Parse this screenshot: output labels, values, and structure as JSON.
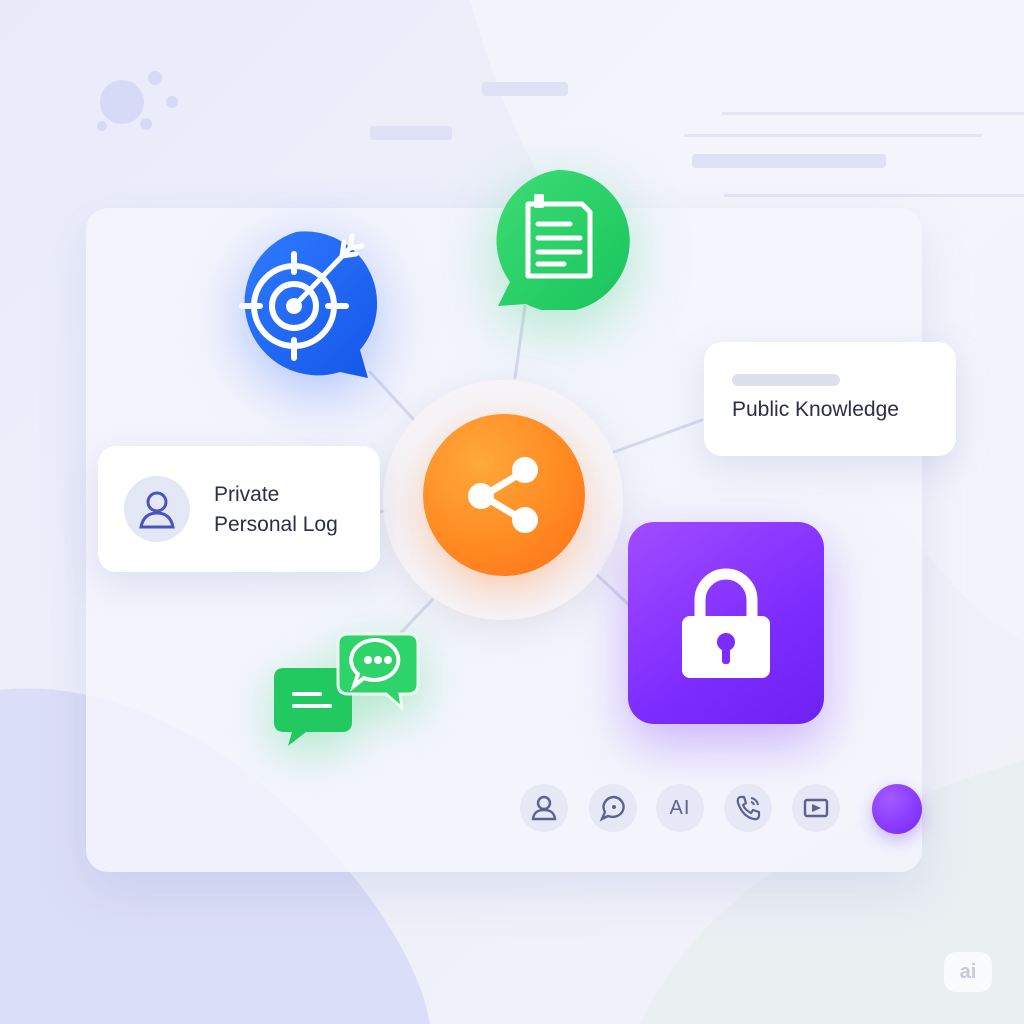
{
  "colors": {
    "target_blue": "#1e66f5",
    "doc_green": "#22cc66",
    "hub_orange": "#ff8a22",
    "lock_purple": "#7d2cff",
    "text_dark": "#2b2f48",
    "icon_muted": "#5b6293"
  },
  "nodes": {
    "target": {
      "icon": "target-icon"
    },
    "document": {
      "icon": "document-icon"
    },
    "hub": {
      "icon": "share-icon"
    },
    "chat": {
      "icon": "chat-bubbles-icon"
    },
    "lock": {
      "icon": "lock-icon"
    }
  },
  "private_card": {
    "line1": "Private",
    "line2": "Personal Log",
    "icon": "user-icon"
  },
  "public_card": {
    "label": "Public Knowledge"
  },
  "toolbar": {
    "items": [
      {
        "icon": "user-icon"
      },
      {
        "icon": "chat-icon"
      },
      {
        "icon": "text-ai-icon",
        "label": "AI"
      },
      {
        "icon": "phone-icon"
      },
      {
        "icon": "video-icon"
      }
    ],
    "status_color": "#8a3cff"
  },
  "watermark": {
    "label": "ai"
  }
}
